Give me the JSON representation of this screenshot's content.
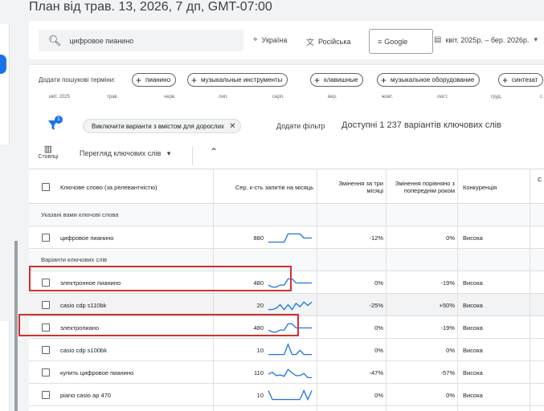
{
  "plan_title": "План від трав. 13, 2026, 7 дп, GMT-07:00",
  "search": {
    "query": "цифровое пианино",
    "location": "Україна",
    "language": "Російська",
    "network": "Google",
    "date_range": "квіт. 2025р. – бер. 2026р."
  },
  "add_terms": {
    "label": "Додати пошукові терміни:",
    "chips": [
      "пианино",
      "музыкальные инструменты",
      "клавишные",
      "музыкальное оборудование",
      "синтезат"
    ]
  },
  "months": [
    "квіт. 2025",
    "трав.",
    "черв.",
    "лип.",
    "серп.",
    "вер.",
    "жовт.",
    "лист.",
    "груд.",
    "с"
  ],
  "filters": {
    "badge": "1",
    "active_chip": "Виключити варіанти з вмістом для дорослих",
    "add_filter": "Додати фільтр",
    "available": "Доступні 1 237 варіантів ключових слів"
  },
  "toolbar": {
    "columns": "Стовпці",
    "view": "Перегляд ключових слів"
  },
  "table": {
    "headers": {
      "keyword": "Ключове слово (за релевантністю)",
      "avg": "Сер. к-сть запитів на місяць",
      "three_month": "Змінення за три місяці",
      "yoy": "Змінення порівняно з попереднім роком",
      "competition": "Конкуренція",
      "extra": "С"
    },
    "section_provided": "Указані вами ключові слова",
    "provided_rows": [
      {
        "keyword": "цифровое пианино",
        "avg": "880",
        "three_month": "-12%",
        "yoy": "0%",
        "competition": "Висока",
        "trend": [
          0.2,
          0.2,
          0.2,
          0.2,
          0.2,
          0.8,
          0.8,
          0.8,
          0.8,
          0.5,
          0.5,
          0.5
        ]
      }
    ],
    "section_ideas": "Варіанти ключових слів",
    "idea_rows": [
      {
        "keyword": "электронное пианино",
        "avg": "480",
        "three_month": "0%",
        "yoy": "-19%",
        "competition": "Висока",
        "trend": [
          0.35,
          0.2,
          0.2,
          0.35,
          0.35,
          0.8,
          0.8,
          0.5,
          0.5,
          0.5,
          0.5,
          0.5
        ]
      },
      {
        "keyword": "casio cdp s110bk",
        "avg": "20",
        "three_month": "-25%",
        "yoy": "+50%",
        "competition": "Висока",
        "trend": [
          0.2,
          0.2,
          0.3,
          0.55,
          0.2,
          0.55,
          0.2,
          0.65,
          0.4,
          0.75,
          0.5,
          0.75
        ]
      },
      {
        "keyword": "электропиано",
        "avg": "480",
        "three_month": "0%",
        "yoy": "-19%",
        "competition": "Висока",
        "trend": [
          0.35,
          0.2,
          0.2,
          0.35,
          0.35,
          0.8,
          0.8,
          0.5,
          0.5,
          0.5,
          0.5,
          0.5
        ]
      },
      {
        "keyword": "casio cdp s100bk",
        "avg": "10",
        "three_month": "0%",
        "yoy": "0%",
        "competition": "Висока",
        "trend": [
          0.2,
          0.2,
          0.2,
          0.2,
          0.2,
          0.95,
          0.2,
          0.2,
          0.5,
          0.2,
          0.2,
          0.2
        ]
      },
      {
        "keyword": "купить цифровое пианино",
        "avg": "110",
        "three_month": "-47%",
        "yoy": "-57%",
        "competition": "Висока",
        "trend": [
          0.4,
          0.55,
          0.3,
          0.35,
          0.25,
          0.75,
          0.5,
          0.3,
          0.3,
          0.45,
          0.15,
          0.15
        ]
      },
      {
        "keyword": "piano casio ap 470",
        "avg": "10",
        "three_month": "0%",
        "yoy": "0%",
        "competition": "Висока",
        "trend": [
          0.85,
          0.2,
          0.2,
          0.2,
          0.2,
          0.2,
          0.2,
          0.2,
          0.2,
          0.85,
          0.2,
          0.85
        ]
      }
    ]
  },
  "colors": {
    "accent": "#1a73e8",
    "highlight": "#d32f2f",
    "sparkline": "#1a73e8"
  }
}
